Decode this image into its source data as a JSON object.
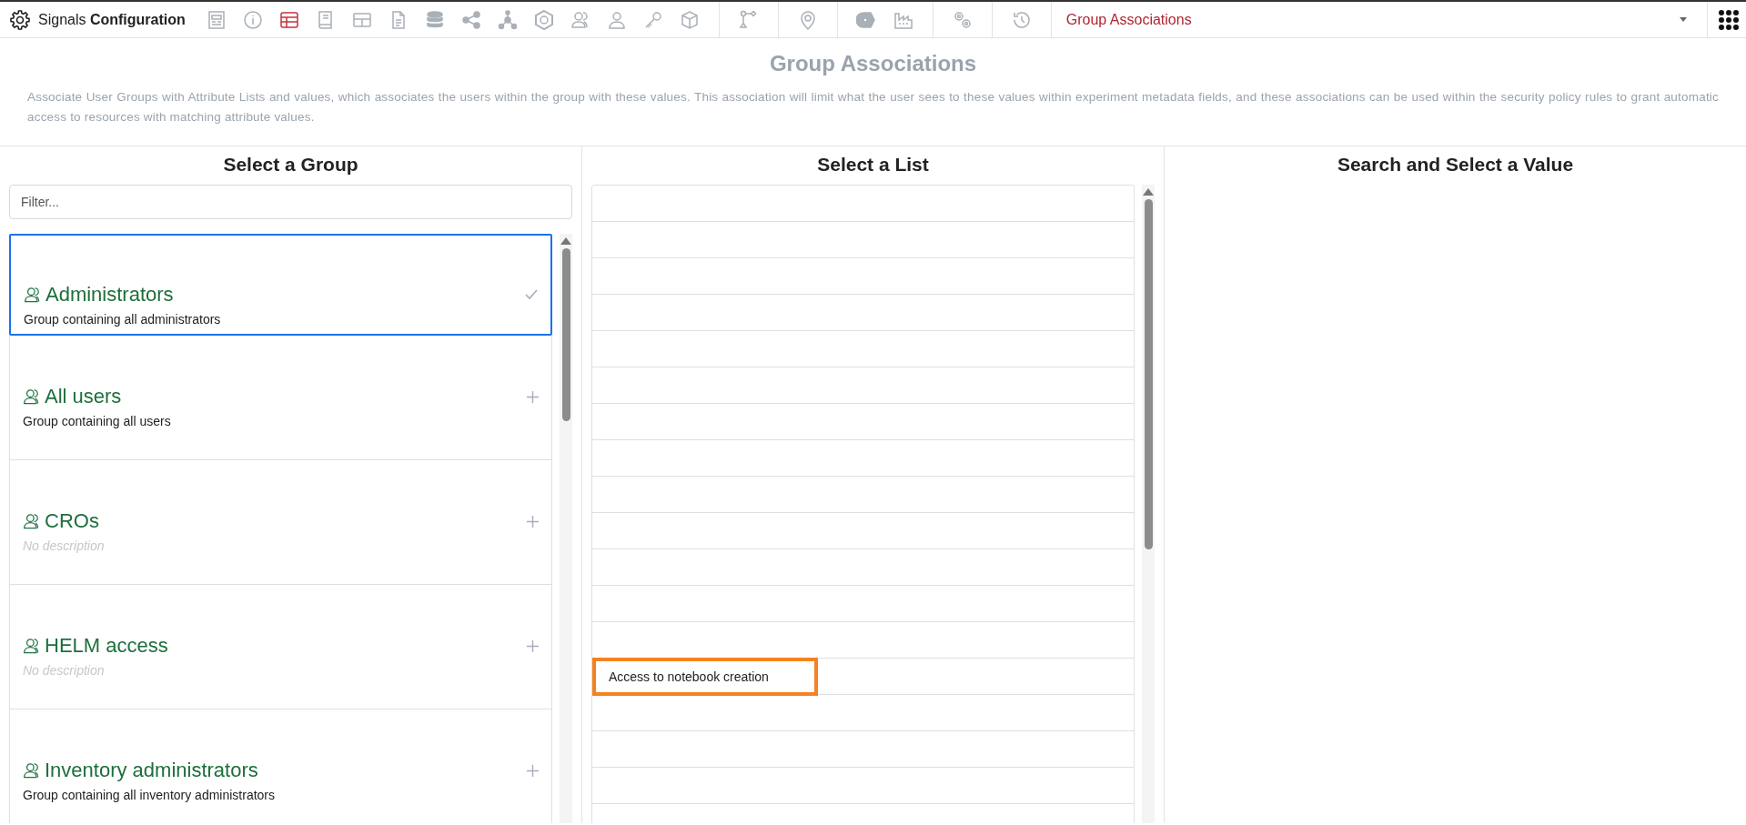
{
  "app": {
    "title_light": "Signals",
    "title_bold": "Configuration"
  },
  "toolbar": {
    "icons": [
      {
        "kind": "layout",
        "selected": false
      },
      {
        "kind": "info",
        "selected": false
      },
      {
        "kind": "table",
        "selected": true
      },
      {
        "kind": "book",
        "selected": false
      },
      {
        "kind": "grid",
        "selected": false
      },
      {
        "kind": "document",
        "selected": false
      },
      {
        "kind": "database",
        "selected": false
      },
      {
        "kind": "share",
        "selected": false
      },
      {
        "kind": "network",
        "selected": false
      },
      {
        "kind": "hexagon",
        "selected": false
      },
      {
        "kind": "users",
        "selected": false
      },
      {
        "kind": "user",
        "selected": false
      },
      {
        "kind": "key",
        "selected": false
      },
      {
        "kind": "cube",
        "selected": false
      },
      {
        "kind": "divider"
      },
      {
        "kind": "flow",
        "selected": false
      },
      {
        "kind": "divider"
      },
      {
        "kind": "pin",
        "selected": false
      },
      {
        "kind": "divider"
      },
      {
        "kind": "tag",
        "selected": false
      },
      {
        "kind": "factory",
        "selected": false
      },
      {
        "kind": "divider"
      },
      {
        "kind": "gears",
        "selected": false
      },
      {
        "kind": "divider"
      },
      {
        "kind": "history",
        "selected": false
      },
      {
        "kind": "divider"
      }
    ],
    "page_select": "Group Associations"
  },
  "page": {
    "title": "Group Associations",
    "description": "Associate User Groups with Attribute Lists and values, which associates the users within the group with these values. This association will limit what the user sees to these values within experiment metadata fields, and these associations can be used within the security policy rules to grant automatic access to resources with matching attribute values."
  },
  "groups_panel": {
    "heading": "Select a Group",
    "filter": {
      "placeholder": "Filter..."
    },
    "groups": [
      {
        "name": "Administrators",
        "description": "Group containing all administrators",
        "has_description": true,
        "selected": true
      },
      {
        "name": "All users",
        "description": "Group containing all users",
        "has_description": true,
        "selected": false
      },
      {
        "name": "CROs",
        "description": "No description",
        "has_description": false,
        "selected": false
      },
      {
        "name": "HELM access",
        "description": "No description",
        "has_description": false,
        "selected": false
      },
      {
        "name": "Inventory administrators",
        "description": "Group containing all inventory administrators",
        "has_description": true,
        "selected": false
      }
    ]
  },
  "lists_panel": {
    "heading": "Select a List",
    "rows": [
      {},
      {},
      {},
      {},
      {},
      {},
      {},
      {},
      {},
      {},
      {},
      {},
      {},
      {
        "label": "Access to notebook creation",
        "highlighted": true
      },
      {},
      {},
      {},
      {}
    ]
  },
  "values_panel": {
    "heading": "Search and Select a Value"
  }
}
